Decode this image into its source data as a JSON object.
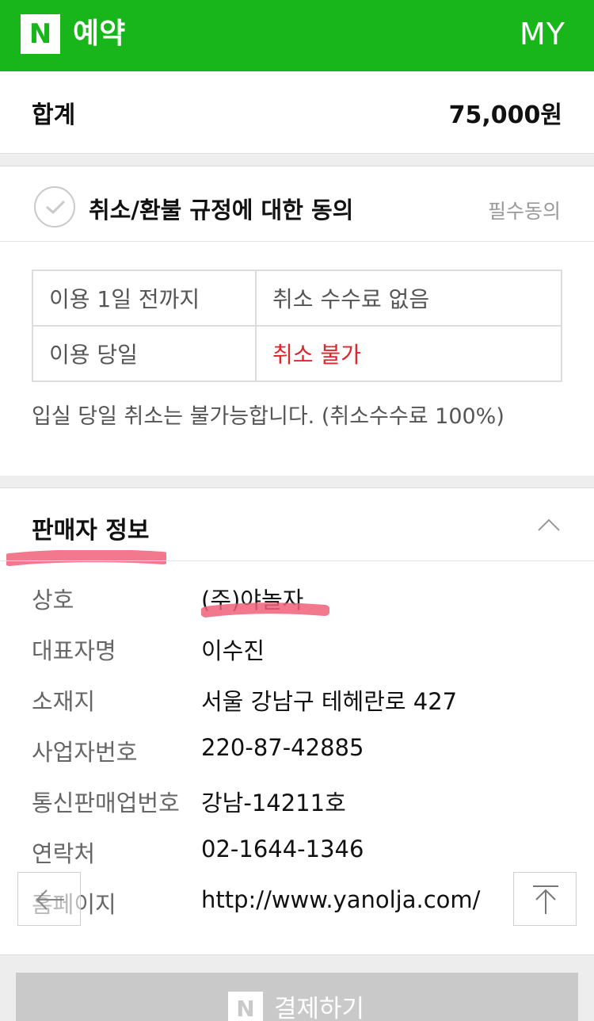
{
  "header": {
    "logo_text": "N",
    "title": "예약",
    "my_label": "MY",
    "brand_color": "#19b61b"
  },
  "total": {
    "label": "합계",
    "amount": "75,000원"
  },
  "agreement": {
    "title": "취소/환불 규정에 대한 동의",
    "required_label": "필수동의",
    "checked": false,
    "rows": [
      {
        "when": "이용 1일 전까지",
        "fee": "취소 수수료 없음"
      },
      {
        "when": "이용 당일",
        "fee": "취소 불가"
      }
    ],
    "note": "입실 당일 취소는 불가능합니다. (취소수수료 100%)"
  },
  "seller": {
    "title": "판매자 정보",
    "rows": [
      {
        "label": "상호",
        "value": "(주)야놀자"
      },
      {
        "label": "대표자명",
        "value": "이수진"
      },
      {
        "label": "소재지",
        "value": "서울 강남구 테헤란로 427"
      },
      {
        "label": "사업자번호",
        "value": "220-87-42885"
      },
      {
        "label": "통신판매업번호",
        "value": "강남-14211호"
      },
      {
        "label": "연락처",
        "value": "02-1644-1346"
      },
      {
        "label": "홈페이지",
        "value": "http://www.yanolja.com/"
      }
    ]
  },
  "pay": {
    "logo_text": "N",
    "label": "결제하기"
  },
  "colors": {
    "danger": "#e0252b",
    "highlight": "#f0607a"
  }
}
